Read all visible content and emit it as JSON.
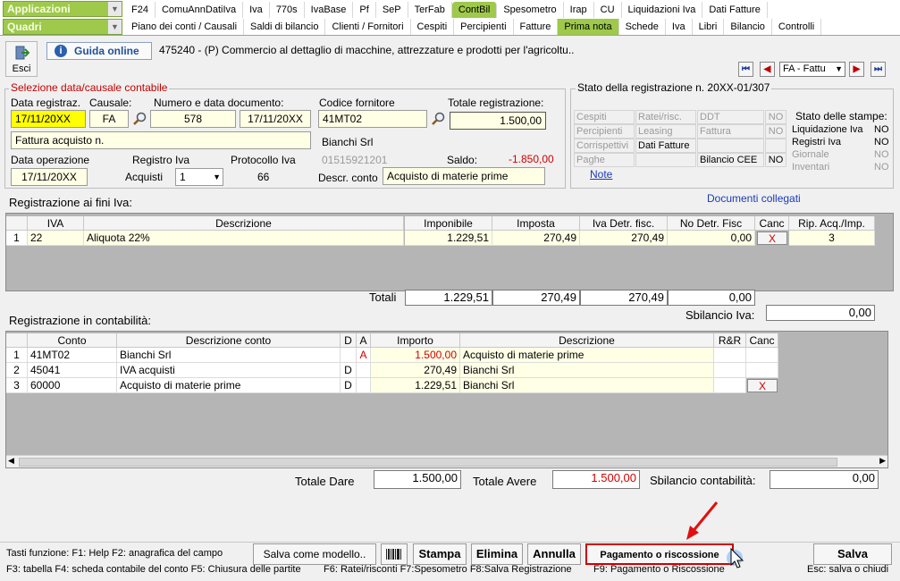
{
  "nav": {
    "applicazioni": "Applicazioni",
    "quadri": "Quadri",
    "row1": [
      "F24",
      "ComuAnnDatiIva",
      "Iva",
      "770s",
      "IvaBase",
      "Pf",
      "SeP",
      "TerFab",
      "ContBil",
      "Spesometro",
      "Irap",
      "CU",
      "Liquidazioni Iva",
      "Dati Fatture"
    ],
    "row2": [
      "Piano dei conti / Causali",
      "Saldi di bilancio",
      "Clienti / Fornitori",
      "Cespiti",
      "Percipienti",
      "Fatture",
      "Prima nota",
      "Schede",
      "Iva",
      "Libri",
      "Bilancio",
      "Controlli"
    ]
  },
  "toolbar": {
    "esci": "Esci",
    "guida": "Guida online",
    "ditta": "475240 - (P) Commercio al dettaglio di macchine, attrezzature e prodotti per l'agricoltu..",
    "nav_select": "FA - Fattu"
  },
  "selezione": {
    "title": "Selezione data/causale contabile",
    "data_label": "Data registraz.",
    "data_value": "17/11/20XX",
    "causale_label": "Causale:",
    "causale_value": "FA",
    "numero_label": "Numero e data documento:",
    "numero_value": "578",
    "data_doc_value": "17/11/20XX",
    "desc_causale": "Fattura acquisto n.",
    "data_op_label": "Data operazione",
    "data_op_value": "17/11/20XX",
    "registro_label": "Registro Iva",
    "registro_value": "Acquisti",
    "registro_num": "1",
    "protocollo_label": "Protocollo Iva",
    "protocollo_value": "66"
  },
  "fornitore": {
    "codice_label": "Codice fornitore",
    "codice_value": "41MT02",
    "totale_label": "Totale registrazione:",
    "totale_value": "1.500,00",
    "nome": "Bianchi Srl",
    "piva": "01515921201",
    "saldo_label": "Saldo:",
    "saldo_value": "-1.850,00",
    "descr_label": "Descr. conto",
    "descr_value": "Acquisto di materie prime"
  },
  "stato": {
    "title": "Stato della registrazione n. 20XX-01/307",
    "rows": [
      [
        "Cespiti",
        "Ratei/risc.",
        "DDT",
        "NO"
      ],
      [
        "Percipienti",
        "Leasing",
        "Fattura",
        "NO"
      ],
      [
        "Corrispettivi",
        "Dati Fatture",
        "",
        ""
      ],
      [
        "Paghe",
        "",
        "Bilancio CEE",
        "NO"
      ]
    ],
    "note": "Note",
    "stampe_title": "Stato delle stampe:",
    "stampe": [
      [
        "Liquidazione Iva",
        "NO"
      ],
      [
        "Registri Iva",
        "NO"
      ],
      [
        "Giornale",
        "NO"
      ],
      [
        "Inventari",
        "NO"
      ]
    ],
    "documenti": "Documenti collegati"
  },
  "iva": {
    "title": "Registrazione ai fini Iva:",
    "headers": [
      "IVA",
      "Descrizione",
      "Imponibile",
      "Imposta",
      "Iva Detr. fisc.",
      "No Detr. Fisc",
      "Canc",
      "Rip. Acq./Imp."
    ],
    "rows": [
      {
        "n": "1",
        "iva": "22",
        "desc": "Aliquota 22%",
        "imponibile": "1.229,51",
        "imposta": "270,49",
        "detr": "270,49",
        "nodetr": "0,00",
        "canc": "X",
        "rip": "3"
      }
    ],
    "totali_label": "Totali",
    "totali": [
      "1.229,51",
      "270,49",
      "270,49",
      "0,00"
    ],
    "sbilancio_label": "Sbilancio Iva:",
    "sbilancio_value": "0,00"
  },
  "contabilita": {
    "title": "Registrazione in contabilità:",
    "headers": [
      "Conto",
      "Descrizione conto",
      "D",
      "A",
      "Importo",
      "Descrizione",
      "R&R",
      "Canc"
    ],
    "rows": [
      {
        "n": "1",
        "conto": "41MT02",
        "desc": "Bianchi Srl",
        "d": "",
        "a": "A",
        "importo": "1.500,00",
        "descr": "Acquisto di materie prime",
        "canc": ""
      },
      {
        "n": "2",
        "conto": "45041",
        "desc": "IVA acquisti",
        "d": "D",
        "a": "",
        "importo": "270,49",
        "descr": "Bianchi Srl",
        "canc": ""
      },
      {
        "n": "3",
        "conto": "60000",
        "desc": "Acquisto di materie prime",
        "d": "D",
        "a": "",
        "importo": "1.229,51",
        "descr": "Bianchi Srl",
        "canc": "X"
      }
    ],
    "dare_label": "Totale Dare",
    "dare_value": "1.500,00",
    "avere_label": "Totale Avere",
    "avere_value": "1.500,00",
    "sbil_label": "Sbilancio contabilità:",
    "sbil_value": "0,00"
  },
  "footer": {
    "tasti": "Tasti funzione:  F1: Help   F2: anagrafica del campo",
    "salva_modello": "Salva come modello..",
    "stampa": "Stampa",
    "elimina": "Elimina",
    "annulla": "Annulla",
    "pagamento": "Pagamento o riscossione",
    "salva": "Salva",
    "line2a": "F3: tabella   F4: scheda contabile del conto   F5: Chiusura delle partite",
    "line2b": "F6: Ratei/risconti   F7:Spesometro   F8:Salva Registrazione",
    "line2c": "F9: Pagamento o Riscossione",
    "esc": "Esc: salva o chiudi"
  },
  "colors": {
    "accent_green": "#9ec94a",
    "highlight_red": "#d00000",
    "field_yellow": "#ffffe6"
  }
}
